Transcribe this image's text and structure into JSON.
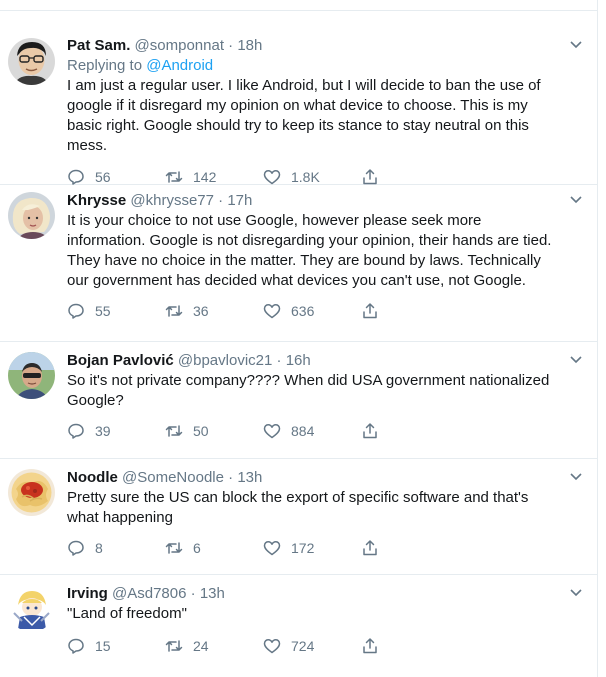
{
  "tweets": [
    {
      "name": "Pat Sam.",
      "handle": "@somponnat",
      "dot": " · ",
      "time": "18h",
      "replying_prefix": "Replying to ",
      "replying_to": "@Android",
      "text": "I am just a regular user. I like Android, but I will decide to ban the use of google if it disregard my opinion on what device to choose. This is my basic right. Google should try to keep its stance to stay neutral on this mess.",
      "replies": "56",
      "retweets": "142",
      "likes": "1.8K"
    },
    {
      "name": "Khrysse",
      "handle": "@khrysse77",
      "dot": " · ",
      "time": "17h",
      "text": "It is your choice to not use Google, however please seek more information. Google is not disregarding your opinion, their hands are tied. They have no choice in the matter. They are bound by laws. Technically our government has decided what devices you can't use, not Google.",
      "replies": "55",
      "retweets": "36",
      "likes": "636"
    },
    {
      "name": "Bojan Pavlović",
      "handle": "@bpavlovic21",
      "dot": " · ",
      "time": "16h",
      "text": "So it's not private company???? When did USA government nationalized Google?",
      "replies": "39",
      "retweets": "50",
      "likes": "884"
    },
    {
      "name": "Noodle",
      "handle": "@SomeNoodle",
      "dot": " · ",
      "time": "13h",
      "text": "Pretty sure the US can block the export of specific software and that's what happening",
      "replies": "8",
      "retweets": "6",
      "likes": "172"
    },
    {
      "name": "Irving",
      "handle": "@Asd7806",
      "dot": " · ",
      "time": "13h",
      "text": "\"Land of freedom\"",
      "replies": "15",
      "retweets": "24",
      "likes": "724"
    }
  ],
  "icons": {
    "reply": "reply-icon",
    "retweet": "retweet-icon",
    "like": "like-icon",
    "share": "share-icon",
    "more": "chevron-down-icon"
  },
  "colors": {
    "text": "#14171a",
    "secondary": "#657786",
    "link": "#1da1f2",
    "divider": "#e6ecf0"
  }
}
